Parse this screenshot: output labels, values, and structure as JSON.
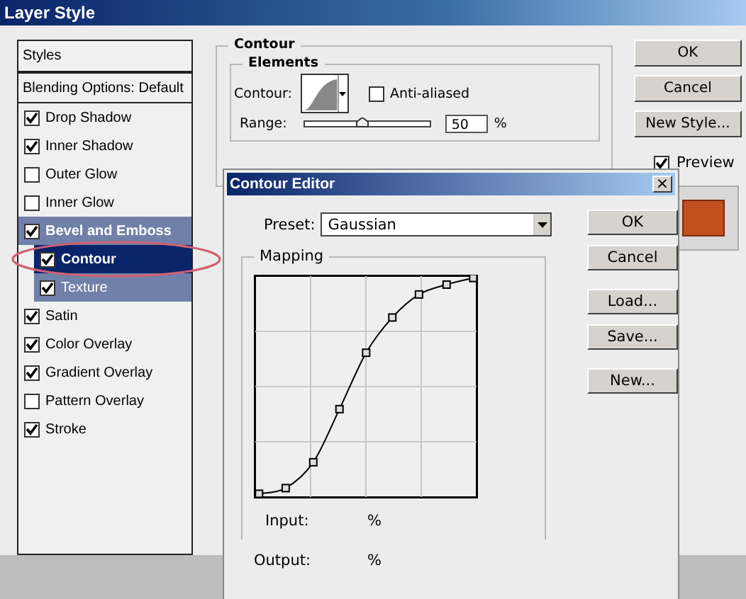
{
  "window": {
    "title": "Layer Style"
  },
  "styles_panel": {
    "header": "Styles",
    "blending": "Blending Options: Default",
    "items": [
      {
        "label": "Drop Shadow",
        "checked": true,
        "selected": false,
        "highlighted": false,
        "circled": false
      },
      {
        "label": "Inner Shadow",
        "checked": true,
        "selected": false,
        "highlighted": false,
        "circled": false
      },
      {
        "label": "Outer Glow",
        "checked": false,
        "selected": false,
        "highlighted": false,
        "circled": false
      },
      {
        "label": "Inner Glow",
        "checked": false,
        "selected": false,
        "highlighted": false,
        "circled": false
      },
      {
        "label": "Bevel and Emboss",
        "checked": true,
        "selected": false,
        "highlighted": true,
        "circled": false,
        "children": [
          {
            "label": "Contour",
            "checked": true,
            "selected": true,
            "circled": true
          },
          {
            "label": "Texture",
            "checked": true,
            "selected": false,
            "highlighted": true,
            "circled": false
          }
        ]
      },
      {
        "label": "Satin",
        "checked": true,
        "selected": false,
        "highlighted": false,
        "circled": false
      },
      {
        "label": "Color Overlay",
        "checked": true,
        "selected": false,
        "highlighted": false,
        "circled": false
      },
      {
        "label": "Gradient Overlay",
        "checked": true,
        "selected": false,
        "highlighted": false,
        "circled": false
      },
      {
        "label": "Pattern Overlay",
        "checked": false,
        "selected": false,
        "highlighted": false,
        "circled": false
      },
      {
        "label": "Stroke",
        "checked": true,
        "selected": false,
        "highlighted": false,
        "circled": false
      }
    ]
  },
  "contour_group": {
    "title": "Contour",
    "elements_title": "Elements",
    "contour_label": "Contour:",
    "anti_aliased": {
      "label": "Anti-aliased",
      "checked": false
    },
    "range": {
      "label": "Range:",
      "level": 0.45,
      "value": "50",
      "unit": "%"
    }
  },
  "buttons": [
    "OK",
    "Cancel",
    "New Style..."
  ],
  "preview": {
    "label": "Preview",
    "checked": true
  },
  "contour_editor": {
    "title": "Contour Editor",
    "close": "×",
    "preset_label": "Preset:",
    "preset": "Gaussian",
    "mapping_title": "Mapping",
    "input_label": "Input:",
    "input_unit": "%",
    "output_label": "Output:",
    "output_unit": "%",
    "buttons": [
      "OK",
      "Cancel",
      "Load...",
      "Save...",
      "New..."
    ]
  }
}
